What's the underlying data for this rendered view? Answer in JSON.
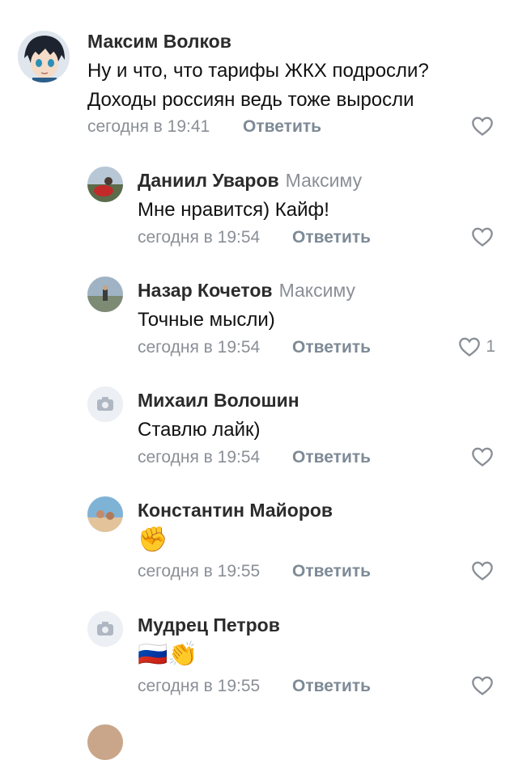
{
  "comments": [
    {
      "author": "Максим Волков",
      "reply_to": "",
      "lines": [
        "Ну и что, что тарифы ЖКХ подросли?",
        "Доходы россиян ведь тоже выросли"
      ],
      "time": "сегодня в 19:41",
      "reply_label": "Ответить",
      "likes": "",
      "avatar": "anime-avatar"
    },
    {
      "author": "Даниил Уваров",
      "reply_to": "Максиму",
      "lines": [
        "Мне нравится) Кайф!"
      ],
      "time": "сегодня в 19:54",
      "reply_label": "Ответить",
      "likes": "",
      "avatar": "photo-avatar"
    },
    {
      "author": "Назар Кочетов",
      "reply_to": "Максиму",
      "lines": [
        "Точные мысли)"
      ],
      "time": "сегодня в 19:54",
      "reply_label": "Ответить",
      "likes": "1",
      "avatar": "photo-avatar"
    },
    {
      "author": "Михаил Волошин",
      "reply_to": "",
      "lines": [
        "Ставлю лайк)"
      ],
      "time": "сегодня в 19:54",
      "reply_label": "Ответить",
      "likes": "",
      "avatar": "camera-placeholder-icon"
    },
    {
      "author": "Константин Майоров",
      "reply_to": "",
      "lines": [
        "✊"
      ],
      "time": "сегодня в 19:55",
      "reply_label": "Ответить",
      "likes": "",
      "avatar": "photo-avatar"
    },
    {
      "author": "Мудрец Петров",
      "reply_to": "",
      "lines": [
        "🇷🇺👏"
      ],
      "time": "сегодня в 19:55",
      "reply_label": "Ответить",
      "likes": "",
      "avatar": "camera-placeholder-icon"
    }
  ]
}
